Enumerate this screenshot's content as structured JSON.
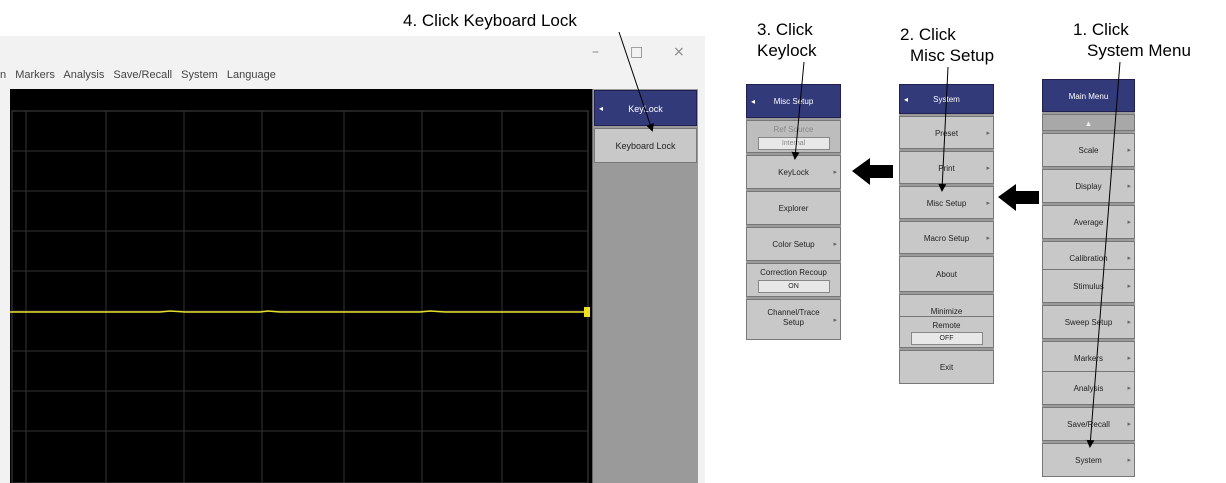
{
  "annotations": {
    "step4": "4. Click Keyboard Lock",
    "step3_line1": "3. Click",
    "step3_line2": "Keylock",
    "step2_line1": "2. Click",
    "step2_line2": "Misc Setup",
    "step1_line1": "1. Click",
    "step1_line2": "System Menu"
  },
  "window": {
    "controls": {
      "minimize": "–",
      "maximize": "□",
      "close": "×"
    },
    "menubar": [
      "n",
      "Markers",
      "Analysis",
      "Save/Recall",
      "System",
      "Language"
    ]
  },
  "keylock_panel": {
    "header": "KeyLock",
    "back_icon": "◂",
    "keys": [
      "Keyboard Lock"
    ]
  },
  "misc_setup_panel": {
    "header": "Misc Setup",
    "back_icon": "◂",
    "ref_source_label": "Ref Source",
    "ref_source_value": "Internal",
    "keylock": "KeyLock",
    "explorer": "Explorer",
    "color_setup": "Color Setup",
    "correction_recoup_label": "Correction Recoup",
    "correction_recoup_value": "ON",
    "channel_trace_setup": "Channel/Trace Setup"
  },
  "system_panel": {
    "header": "System",
    "back_icon": "◂",
    "preset": "Preset",
    "print": "Print",
    "misc_setup": "Misc Setup",
    "macro_setup": "Macro Setup",
    "about": "About",
    "minimize": "Minimize",
    "remote_label": "Remote",
    "remote_value": "OFF",
    "exit": "Exit"
  },
  "main_menu_panel": {
    "header": "Main Menu",
    "up_icon": "▲",
    "items": [
      "Scale",
      "Display",
      "Average",
      "Calibration",
      "Stimulus",
      "Sweep Setup",
      "Markers",
      "Analysis",
      "Save/Recall",
      "System"
    ]
  },
  "submenu_icon": "▸",
  "trace_color": "#e8e02a",
  "header_color": "#323a7a"
}
